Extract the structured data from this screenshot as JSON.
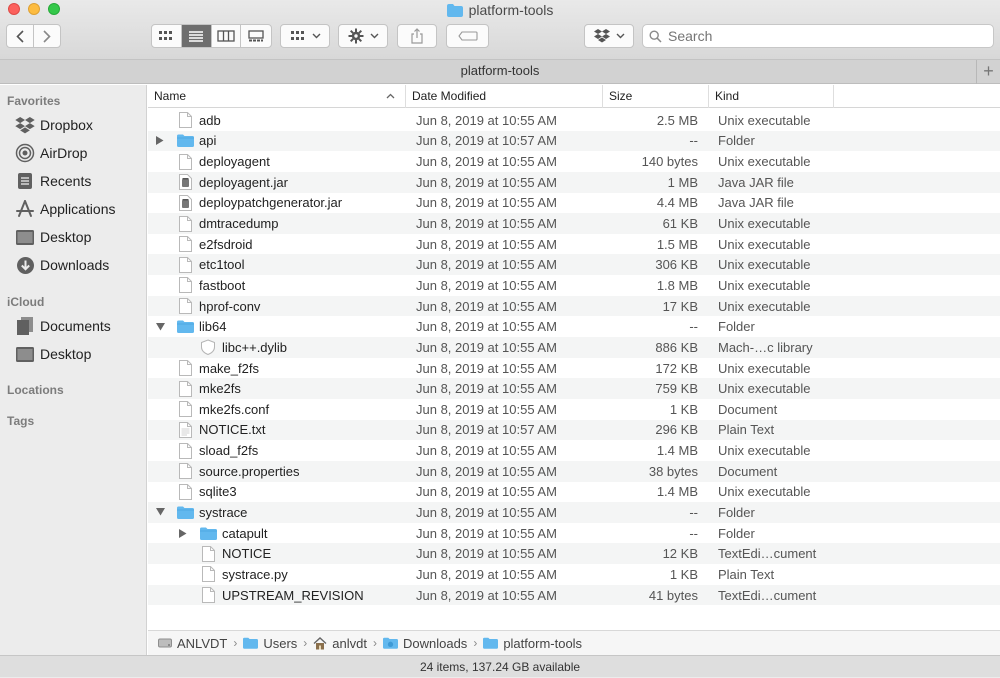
{
  "window": {
    "title": "platform-tools"
  },
  "toolbar": {
    "search_placeholder": "Search"
  },
  "tabbar": {
    "title": "platform-tools",
    "add_label": "+"
  },
  "sidebar": {
    "favorites_label": "Favorites",
    "favorites": [
      {
        "label": "Dropbox",
        "icon": "dropbox-icon"
      },
      {
        "label": "AirDrop",
        "icon": "airdrop-icon"
      },
      {
        "label": "Recents",
        "icon": "recents-icon"
      },
      {
        "label": "Applications",
        "icon": "applications-icon"
      },
      {
        "label": "Desktop",
        "icon": "desktop-icon"
      },
      {
        "label": "Downloads",
        "icon": "downloads-icon"
      }
    ],
    "icloud_label": "iCloud",
    "icloud": [
      {
        "label": "Documents",
        "icon": "documents-icon"
      },
      {
        "label": "Desktop",
        "icon": "desktop-icon"
      }
    ],
    "locations_label": "Locations",
    "tags_label": "Tags"
  },
  "columns": {
    "name": "Name",
    "date": "Date Modified",
    "size": "Size",
    "kind": "Kind"
  },
  "files": [
    {
      "name": "adb",
      "date": "Jun 8, 2019 at 10:55 AM",
      "size": "2.5 MB",
      "kind": "Unix executable",
      "icon": "file",
      "level": 0
    },
    {
      "name": "api",
      "date": "Jun 8, 2019 at 10:57 AM",
      "size": "--",
      "kind": "Folder",
      "icon": "folder",
      "level": 0,
      "disclosure": "collapsed"
    },
    {
      "name": "deployagent",
      "date": "Jun 8, 2019 at 10:55 AM",
      "size": "140 bytes",
      "kind": "Unix executable",
      "icon": "file",
      "level": 0
    },
    {
      "name": "deployagent.jar",
      "date": "Jun 8, 2019 at 10:55 AM",
      "size": "1 MB",
      "kind": "Java JAR file",
      "icon": "jar",
      "level": 0
    },
    {
      "name": "deploypatchgenerator.jar",
      "date": "Jun 8, 2019 at 10:55 AM",
      "size": "4.4 MB",
      "kind": "Java JAR file",
      "icon": "jar",
      "level": 0
    },
    {
      "name": "dmtracedump",
      "date": "Jun 8, 2019 at 10:55 AM",
      "size": "61 KB",
      "kind": "Unix executable",
      "icon": "file",
      "level": 0
    },
    {
      "name": "e2fsdroid",
      "date": "Jun 8, 2019 at 10:55 AM",
      "size": "1.5 MB",
      "kind": "Unix executable",
      "icon": "file",
      "level": 0
    },
    {
      "name": "etc1tool",
      "date": "Jun 8, 2019 at 10:55 AM",
      "size": "306 KB",
      "kind": "Unix executable",
      "icon": "file",
      "level": 0
    },
    {
      "name": "fastboot",
      "date": "Jun 8, 2019 at 10:55 AM",
      "size": "1.8 MB",
      "kind": "Unix executable",
      "icon": "file",
      "level": 0
    },
    {
      "name": "hprof-conv",
      "date": "Jun 8, 2019 at 10:55 AM",
      "size": "17 KB",
      "kind": "Unix executable",
      "icon": "file",
      "level": 0
    },
    {
      "name": "lib64",
      "date": "Jun 8, 2019 at 10:55 AM",
      "size": "--",
      "kind": "Folder",
      "icon": "folder",
      "level": 0,
      "disclosure": "expanded"
    },
    {
      "name": "libc++.dylib",
      "date": "Jun 8, 2019 at 10:55 AM",
      "size": "886 KB",
      "kind": "Mach-…c library",
      "icon": "dylib",
      "level": 1
    },
    {
      "name": "make_f2fs",
      "date": "Jun 8, 2019 at 10:55 AM",
      "size": "172 KB",
      "kind": "Unix executable",
      "icon": "file",
      "level": 0
    },
    {
      "name": "mke2fs",
      "date": "Jun 8, 2019 at 10:55 AM",
      "size": "759 KB",
      "kind": "Unix executable",
      "icon": "file",
      "level": 0
    },
    {
      "name": "mke2fs.conf",
      "date": "Jun 8, 2019 at 10:55 AM",
      "size": "1 KB",
      "kind": "Document",
      "icon": "file",
      "level": 0
    },
    {
      "name": "NOTICE.txt",
      "date": "Jun 8, 2019 at 10:57 AM",
      "size": "296 KB",
      "kind": "Plain Text",
      "icon": "text",
      "level": 0
    },
    {
      "name": "sload_f2fs",
      "date": "Jun 8, 2019 at 10:55 AM",
      "size": "1.4 MB",
      "kind": "Unix executable",
      "icon": "file",
      "level": 0
    },
    {
      "name": "source.properties",
      "date": "Jun 8, 2019 at 10:55 AM",
      "size": "38 bytes",
      "kind": "Document",
      "icon": "file",
      "level": 0
    },
    {
      "name": "sqlite3",
      "date": "Jun 8, 2019 at 10:55 AM",
      "size": "1.4 MB",
      "kind": "Unix executable",
      "icon": "file",
      "level": 0
    },
    {
      "name": "systrace",
      "date": "Jun 8, 2019 at 10:55 AM",
      "size": "--",
      "kind": "Folder",
      "icon": "folder",
      "level": 0,
      "disclosure": "expanded"
    },
    {
      "name": "catapult",
      "date": "Jun 8, 2019 at 10:55 AM",
      "size": "--",
      "kind": "Folder",
      "icon": "folder",
      "level": 1,
      "disclosure": "collapsed"
    },
    {
      "name": "NOTICE",
      "date": "Jun 8, 2019 at 10:55 AM",
      "size": "12 KB",
      "kind": "TextEdi…cument",
      "icon": "file",
      "level": 1
    },
    {
      "name": "systrace.py",
      "date": "Jun 8, 2019 at 10:55 AM",
      "size": "1 KB",
      "kind": "Plain Text",
      "icon": "file",
      "level": 1
    },
    {
      "name": "UPSTREAM_REVISION",
      "date": "Jun 8, 2019 at 10:55 AM",
      "size": "41 bytes",
      "kind": "TextEdi…cument",
      "icon": "file",
      "level": 1
    }
  ],
  "pathbar": [
    {
      "label": "ANLVDT",
      "icon": "disk-icon"
    },
    {
      "label": "Users",
      "icon": "folder-icon"
    },
    {
      "label": "anlvdt",
      "icon": "home-icon"
    },
    {
      "label": "Downloads",
      "icon": "downloads-folder-icon"
    },
    {
      "label": "platform-tools",
      "icon": "folder-icon"
    }
  ],
  "pathbar_separator": "›",
  "status": {
    "text": "24 items, 137.24 GB available"
  },
  "colors": {
    "folder": "#62b8ee",
    "accent": "#4a90d9"
  }
}
